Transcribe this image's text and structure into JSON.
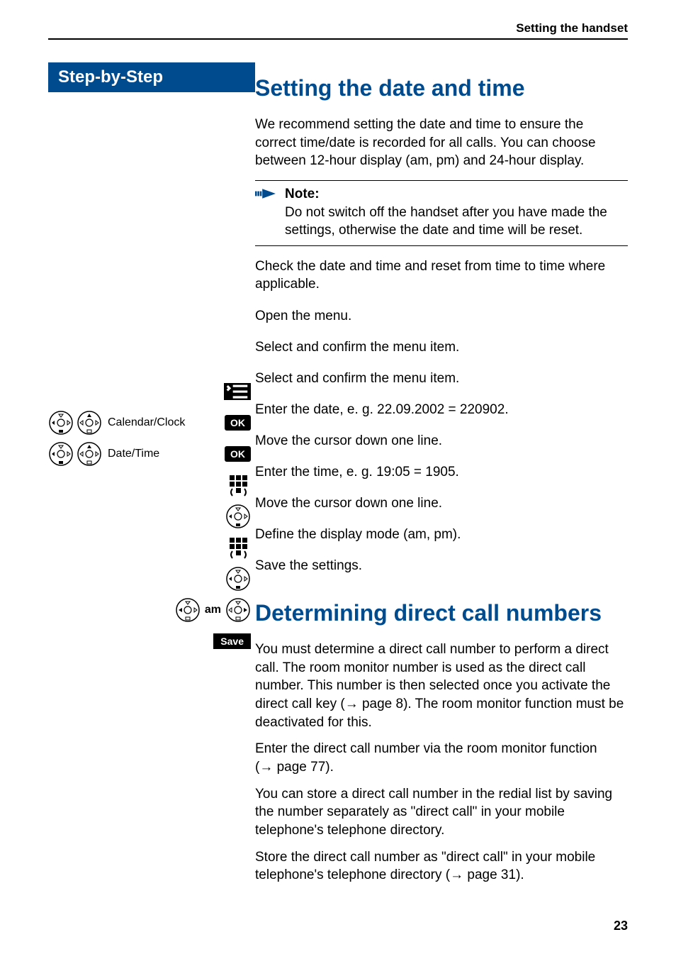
{
  "header": {
    "section": "Setting the handset"
  },
  "sidebar": {
    "title": "Step-by-Step",
    "steps": {
      "menu_item_calendar": "Calendar/Clock",
      "menu_item_datetime": "Date/Time",
      "ok_label": "OK",
      "am_label": "am",
      "save_label": "Save"
    }
  },
  "section1": {
    "heading": "Setting the date and time",
    "intro": "We recommend setting the date and time to ensure the correct time/date is recorded for all calls. You can choose between 12-hour display (am, pm) and 24-hour display.",
    "note_label": "Note:",
    "note_body": "Do not switch off the handset after you have made the settings, otherwise the date and time will be reset.",
    "after_note": "Check the date and time and reset from time to time where applicable.",
    "step_texts": {
      "open_menu": "Open the menu.",
      "select_confirm1": "Select and confirm the menu item.",
      "select_confirm2": "Select and confirm the menu item.",
      "enter_date": "Enter the date, e. g. 22.09.2002 = 220902.",
      "move_down1": "Move the cursor down one line.",
      "enter_time": "Enter the time, e. g. 19:05 = 1905.",
      "move_down2": "Move the cursor down one line.",
      "define_mode": "Define the display mode (am, pm).",
      "save": "Save the settings."
    }
  },
  "section2": {
    "heading": "Determining direct call numbers",
    "p1a": "You must determine a direct call number to perform a direct call. The room monitor number is used as the direct call number. This number is then selected once you activate the direct call key (",
    "p1_ref": "page 8",
    "p1b": "). The room monitor function must be deactivated for this.",
    "p2a": "Enter the direct call number via the room monitor function (",
    "p2_ref": "page 77",
    "p2b": ").",
    "p3": "You can store a direct call number in the redial list by saving the number separately as \"direct call\" in your mobile telephone's telephone directory.",
    "p4a": "Store the direct call number as \"direct call\" in your mobile telephone's telephone directory (",
    "p4_ref": "page 31",
    "p4b": ")."
  },
  "page_number": "23"
}
